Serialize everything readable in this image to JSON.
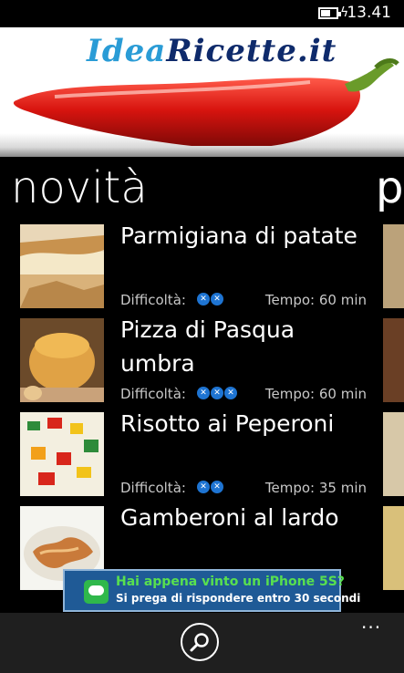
{
  "status_bar": {
    "time": "13.41",
    "battery_icon": "battery-charging-icon"
  },
  "banner": {
    "logo_part1": "Idea",
    "logo_part2": "Ricette.it"
  },
  "panorama": {
    "heading": "novità",
    "next_heading_peek": "p"
  },
  "recipes": [
    {
      "title": "Parmigiana di patate",
      "difficulty_label": "Difficoltà:",
      "difficulty_level": 2,
      "time": "Tempo: 60 min"
    },
    {
      "title": "Pizza di Pasqua umbra",
      "difficulty_label": "Difficoltà:",
      "difficulty_level": 3,
      "time": "Tempo: 60 min"
    },
    {
      "title": "Risotto ai Peperoni",
      "difficulty_label": "Difficoltà:",
      "difficulty_level": 2,
      "time": "Tempo: 35 min"
    },
    {
      "title": "Gamberoni al lardo"
    }
  ],
  "ad": {
    "line1": "Hai appena vinto un iPhone 5S?",
    "line2": "Si prega di rispondere entro 30 secondi"
  },
  "app_bar": {
    "search_icon": "search-icon",
    "more_label": "..."
  },
  "colors": {
    "background": "#000000",
    "accent": "#1e74d2",
    "ad_bg": "#1f5a96",
    "ad_highlight": "#58e04f"
  }
}
